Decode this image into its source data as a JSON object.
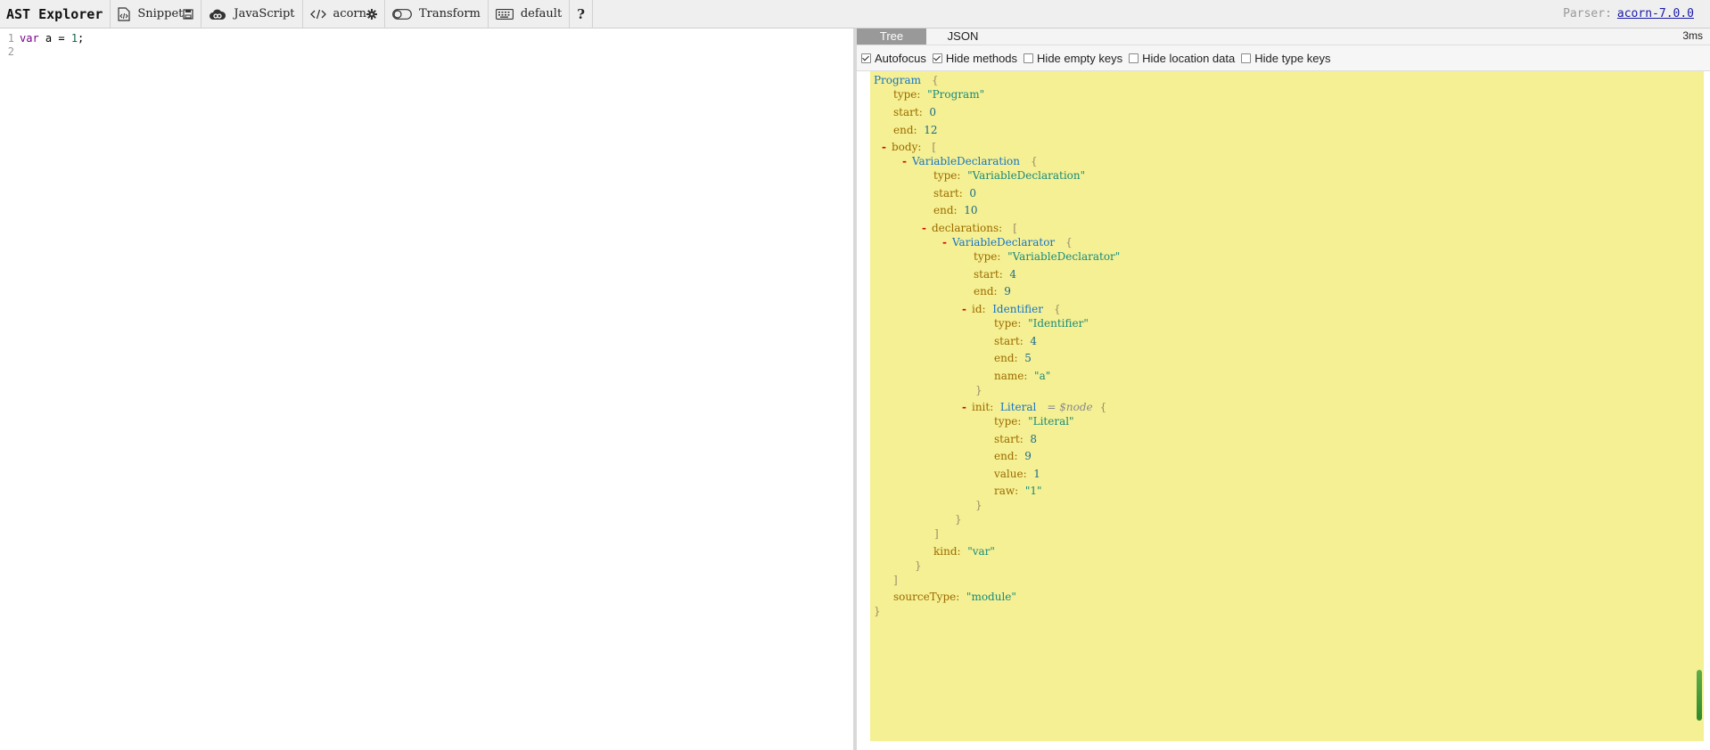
{
  "toolbar": {
    "brand": "AST Explorer",
    "snippet_label": "Snippet",
    "language_label": "JavaScript",
    "parser_name": "acorn",
    "transform_label": "Transform",
    "keymap_label": "default",
    "help_label": "?",
    "parser_prefix": "Parser:",
    "parser_version": "acorn-7.0.0"
  },
  "editor": {
    "lines": [
      {
        "num": "1",
        "code": "var a = 1;"
      },
      {
        "num": "2",
        "code": ""
      }
    ]
  },
  "output": {
    "tabs": [
      "Tree",
      "JSON"
    ],
    "active_tab": "Tree",
    "timing": "3ms",
    "options": [
      {
        "label": "Autofocus",
        "checked": true
      },
      {
        "label": "Hide methods",
        "checked": true
      },
      {
        "label": "Hide empty keys",
        "checked": false
      },
      {
        "label": "Hide location data",
        "checked": false
      },
      {
        "label": "Hide type keys",
        "checked": false
      }
    ]
  },
  "tree": {
    "program": "Program",
    "program_type": "\"Program\"",
    "program_start": "0",
    "program_end": "12",
    "body_key": "body:",
    "var_decl": "VariableDeclaration",
    "var_decl_type": "\"VariableDeclaration\"",
    "var_decl_start": "0",
    "var_decl_end": "10",
    "declarations_key": "declarations:",
    "var_declarator": "VariableDeclarator",
    "var_declarator_type": "\"VariableDeclarator\"",
    "var_declarator_start": "4",
    "var_declarator_end": "9",
    "id_key": "id:",
    "identifier": "Identifier",
    "identifier_type": "\"Identifier\"",
    "identifier_start": "4",
    "identifier_end": "5",
    "identifier_name": "\"a\"",
    "init_key": "init:",
    "literal": "Literal",
    "node_ref": "= $node",
    "literal_type": "\"Literal\"",
    "literal_start": "8",
    "literal_end": "9",
    "literal_value": "1",
    "literal_raw": "\"1\"",
    "kind_value": "\"var\"",
    "source_type": "\"module\"",
    "labels": {
      "type": "type:",
      "start": "start:",
      "end": "end:",
      "name": "name:",
      "value": "value:",
      "raw": "raw:",
      "kind": "kind:",
      "sourceType": "sourceType:"
    },
    "toggle": "-",
    "brace_open": "{",
    "brace_close": "}",
    "bracket_open": "[",
    "bracket_close": "]"
  }
}
